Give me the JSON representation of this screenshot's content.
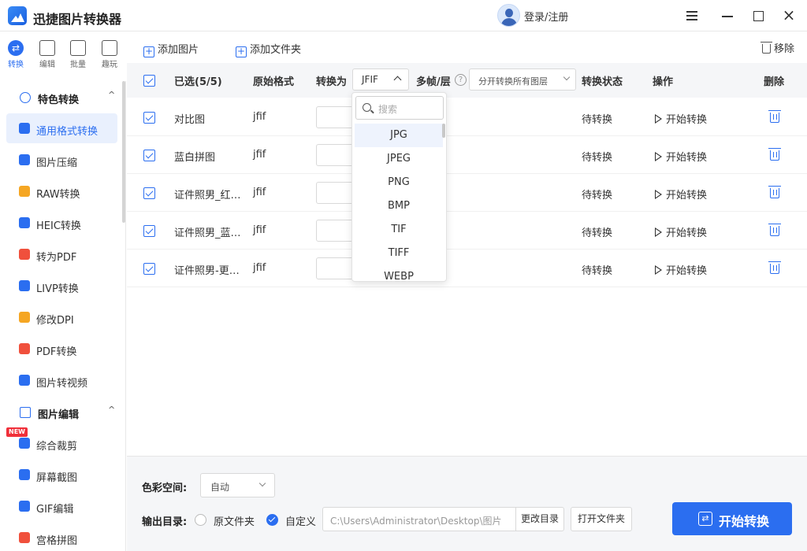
{
  "app": {
    "title": "迅捷图片转换器",
    "login_label": "登录/注册",
    "close_glyph": "×"
  },
  "rail": [
    {
      "label": "转换",
      "icon": "convert-icon",
      "active": true
    },
    {
      "label": "编辑",
      "icon": "edit-icon",
      "active": false
    },
    {
      "label": "批量",
      "icon": "batch-icon",
      "active": false
    },
    {
      "label": "趣玩",
      "icon": "fun-icon",
      "active": false
    }
  ],
  "sidebar": {
    "group1": {
      "label": "特色转换",
      "icon": "hexagon-icon",
      "chevron": "^"
    },
    "items1": [
      {
        "label": "通用格式转换",
        "icon": "convert-icon",
        "color": "#2b6ef0",
        "active": true
      },
      {
        "label": "图片压缩",
        "icon": "compress-icon",
        "color": "#2b6ef0"
      },
      {
        "label": "RAW转换",
        "icon": "raw-icon",
        "color": "#f5a623"
      },
      {
        "label": "HEIC转换",
        "icon": "heic-icon",
        "color": "#2b6ef0"
      },
      {
        "label": "转为PDF",
        "icon": "pdf-icon",
        "color": "#f0503c"
      },
      {
        "label": "LIVP转换",
        "icon": "livp-icon",
        "color": "#2b6ef0"
      },
      {
        "label": "修改DPI",
        "icon": "dpi-icon",
        "color": "#f5a623"
      },
      {
        "label": "PDF转换",
        "icon": "pdf-icon",
        "color": "#f0503c"
      },
      {
        "label": "图片转视频",
        "icon": "video-icon",
        "color": "#2b6ef0"
      }
    ],
    "group2": {
      "label": "图片编辑",
      "icon": "edit-icon",
      "chevron": "^"
    },
    "items2": [
      {
        "label": "综合裁剪",
        "icon": "crop-icon",
        "color": "#2b6ef0"
      },
      {
        "label": "屏幕截图",
        "icon": "screenshot-icon",
        "color": "#2b6ef0"
      },
      {
        "label": "GIF编辑",
        "icon": "gif-icon",
        "color": "#2b6ef0"
      },
      {
        "label": "宫格拼图",
        "icon": "grid-icon",
        "color": "#f0503c"
      }
    ],
    "new_badge": "NEW"
  },
  "toolbar": {
    "add_image": "添加图片",
    "add_folder": "添加文件夹",
    "remove": "移除",
    "plus_glyph": "+"
  },
  "table": {
    "headers": {
      "selected": "已选(5/5)",
      "source_format": "原始格式",
      "convert_to": "转换为",
      "multi_frame": "多帧/层",
      "status": "转换状态",
      "action": "操作",
      "delete": "删除"
    },
    "help_glyph": "?",
    "convert_value": "JFIF",
    "layer_value": "分开转换所有图层",
    "rows": [
      {
        "name": "对比图",
        "format": "jfif",
        "status": "待转换",
        "action": "开始转换"
      },
      {
        "name": "蓝白拼图",
        "format": "jfif",
        "status": "待转换",
        "action": "开始转换"
      },
      {
        "name": "证件照男_红…",
        "format": "jfif",
        "status": "待转换",
        "action": "开始转换"
      },
      {
        "name": "证件照男_蓝…",
        "format": "jfif",
        "status": "待转换",
        "action": "开始转换"
      },
      {
        "name": "证件照男-更…",
        "format": "jfif",
        "status": "待转换",
        "action": "开始转换"
      }
    ]
  },
  "dropdown": {
    "search_placeholder": "搜索",
    "options": [
      "JPG",
      "JPEG",
      "PNG",
      "BMP",
      "TIF",
      "TIFF",
      "WEBP"
    ],
    "highlighted": "JPG"
  },
  "bottom": {
    "color_space_label": "色彩空间:",
    "color_space_value": "自动",
    "output_dir_label": "输出目录:",
    "radio_original": "原文件夹",
    "radio_custom": "自定义",
    "path": "C:\\Users\\Administrator\\Desktop\\图片",
    "change_dir": "更改目录",
    "open_folder": "打开文件夹",
    "start": "开始转换",
    "start_glyph": "⇄"
  },
  "colors": {
    "accent": "#2b6ef0",
    "header_bg": "#f5f6f8",
    "active_bg": "#e9f0fd"
  }
}
